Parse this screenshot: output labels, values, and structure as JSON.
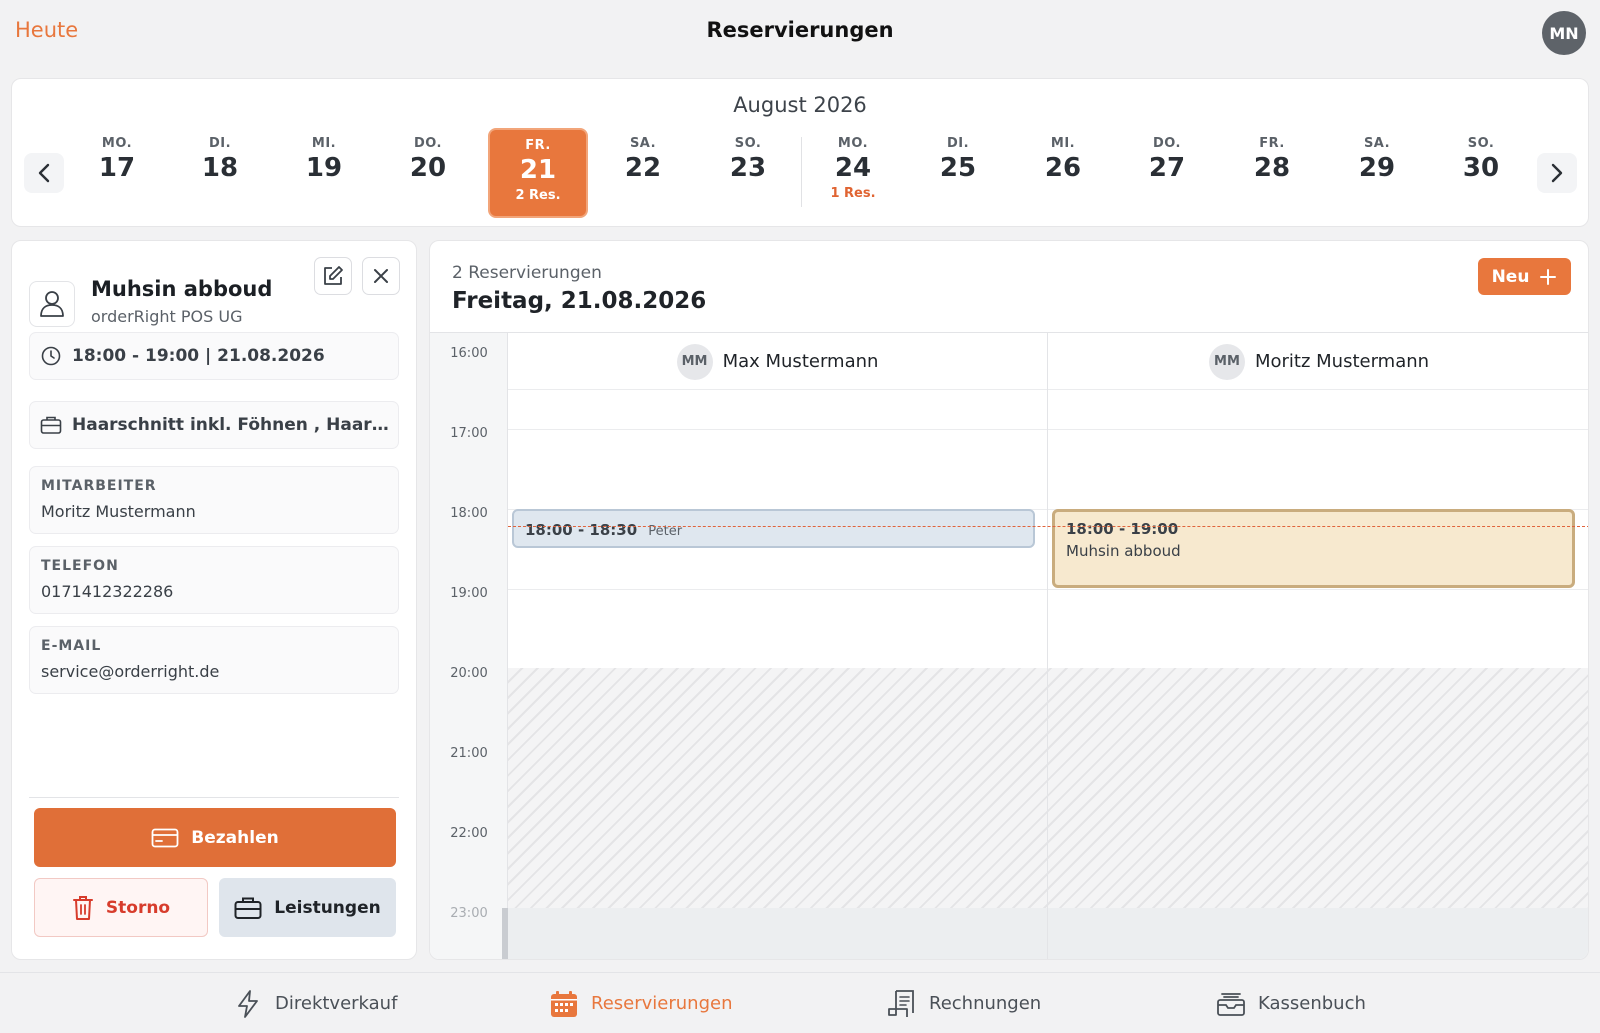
{
  "header": {
    "today": "Heute",
    "title": "Reservierungen",
    "user_initials": "MN"
  },
  "datestrip": {
    "month": "August 2026",
    "days": [
      {
        "weekday": "MO.",
        "day": "17",
        "res": ""
      },
      {
        "weekday": "DI.",
        "day": "18",
        "res": ""
      },
      {
        "weekday": "MI.",
        "day": "19",
        "res": ""
      },
      {
        "weekday": "DO.",
        "day": "20",
        "res": ""
      },
      {
        "weekday": "FR.",
        "day": "21",
        "res": "2 Res."
      },
      {
        "weekday": "SA.",
        "day": "22",
        "res": ""
      },
      {
        "weekday": "SO.",
        "day": "23",
        "res": ""
      },
      {
        "weekday": "MO.",
        "day": "24",
        "res": "1 Res."
      },
      {
        "weekday": "DI.",
        "day": "25",
        "res": ""
      },
      {
        "weekday": "MI.",
        "day": "26",
        "res": ""
      },
      {
        "weekday": "DO.",
        "day": "27",
        "res": ""
      },
      {
        "weekday": "FR.",
        "day": "28",
        "res": ""
      },
      {
        "weekday": "SA.",
        "day": "29",
        "res": ""
      },
      {
        "weekday": "SO.",
        "day": "30",
        "res": ""
      }
    ]
  },
  "detail": {
    "name": "Muhsin abboud",
    "company": "orderRight POS UG",
    "time": "18:00 - 19:00 | 21.08.2026",
    "services": "Haarschnitt inkl. Föhnen , Haarwä...",
    "staff_label": "MITARBEITER",
    "staff_value": "Moritz Mustermann",
    "phone_label": "TELEFON",
    "phone_value": "0171412322286",
    "email_label": "E-MAIL",
    "email_value": "service@orderright.de",
    "pay_label": "Bezahlen",
    "storno_label": "Storno",
    "services_label": "Leistungen"
  },
  "calendar": {
    "count": "2 Reservierungen",
    "date": "Freitag, 21.08.2026",
    "new_label": "Neu",
    "times": [
      "16:00",
      "17:00",
      "18:00",
      "19:00",
      "20:00",
      "21:00",
      "22:00",
      "23:00"
    ],
    "staff": [
      {
        "initials": "MM",
        "name": "Max Mustermann"
      },
      {
        "initials": "MM",
        "name": "Moritz Mustermann"
      }
    ],
    "events": [
      {
        "time": "18:00 - 18:30",
        "name": "Peter"
      },
      {
        "time": "18:00 - 19:00",
        "name": "Muhsin abboud"
      }
    ]
  },
  "tabs": [
    {
      "label": "Direktverkauf",
      "icon": "bolt-icon"
    },
    {
      "label": "Reservierungen",
      "icon": "calendar-icon"
    },
    {
      "label": "Rechnungen",
      "icon": "receipt-icon"
    },
    {
      "label": "Kassenbuch",
      "icon": "cashbook-icon"
    }
  ],
  "colors": {
    "accent": "#e8773d",
    "danger": "#d73c2c"
  }
}
